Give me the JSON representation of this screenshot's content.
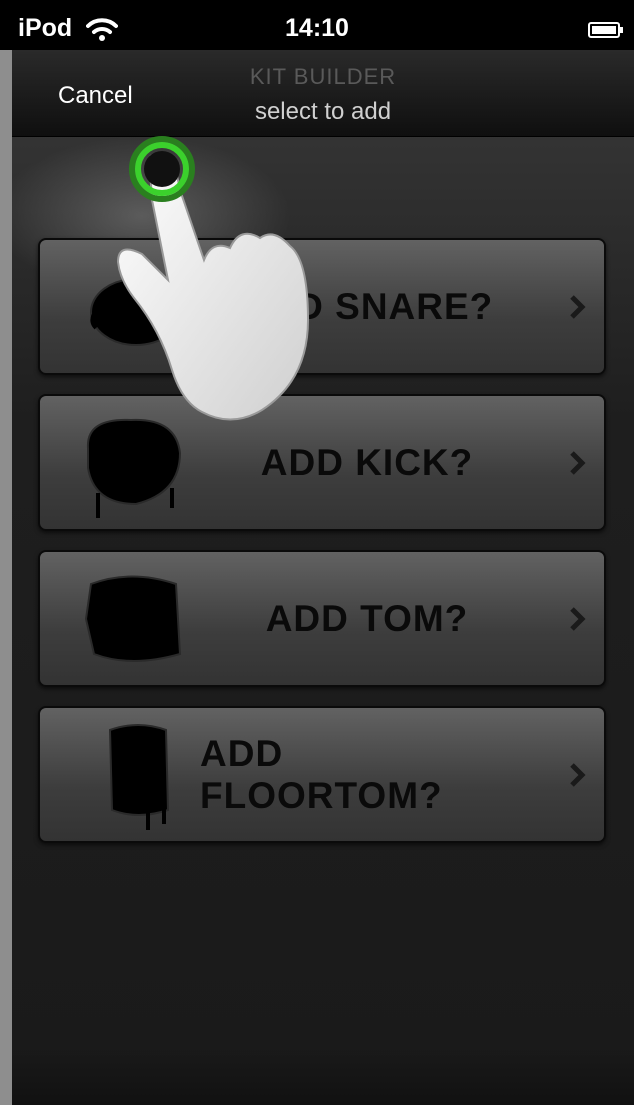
{
  "status_bar": {
    "carrier": "iPod",
    "time": "14:10",
    "wifi_icon": "wifi-icon",
    "battery_icon": "battery-charging-icon"
  },
  "nav": {
    "cancel_label": "Cancel",
    "title": "KIT BUILDER",
    "subtitle": "select to add"
  },
  "rows": [
    {
      "label": "ADD SNARE?",
      "icon": "snare-drum-icon"
    },
    {
      "label": "ADD KICK?",
      "icon": "kick-drum-icon"
    },
    {
      "label": "ADD TOM?",
      "icon": "tom-drum-icon"
    },
    {
      "label": "ADD FLOORTOM?",
      "icon": "floor-tom-drum-icon"
    }
  ],
  "overlay": {
    "icon": "tap-hand-icon",
    "accent_color": "#3bd12c"
  }
}
